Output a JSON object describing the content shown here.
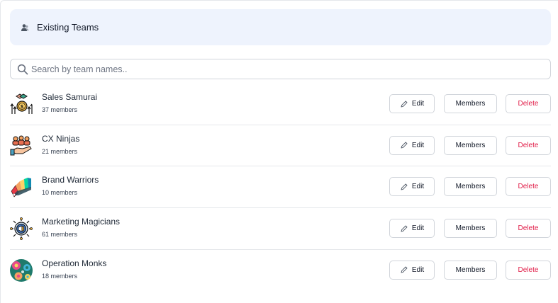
{
  "header": {
    "title": "Existing Teams",
    "icon": "users-icon"
  },
  "search": {
    "placeholder": "Search by team names..",
    "value": ""
  },
  "actions": {
    "edit_label": "Edit",
    "members_label": "Members",
    "delete_label": "Delete"
  },
  "colors": {
    "header_bg": "#eef3fd",
    "delete_text": "#e11d48",
    "border": "#d1d5db"
  },
  "teams": [
    {
      "name": "Sales Samurai",
      "members": "37 members",
      "icon": "money-growth-icon"
    },
    {
      "name": "CX Ninjas",
      "members": "21 members",
      "icon": "hand-people-icon"
    },
    {
      "name": "Brand Warriors",
      "members": "10 members",
      "icon": "color-swatch-icon"
    },
    {
      "name": "Marketing Magicians",
      "members": "61 members",
      "icon": "megaphone-gear-icon"
    },
    {
      "name": "Operation Monks",
      "members": "18 members",
      "icon": "gears-pattern-icon"
    }
  ]
}
